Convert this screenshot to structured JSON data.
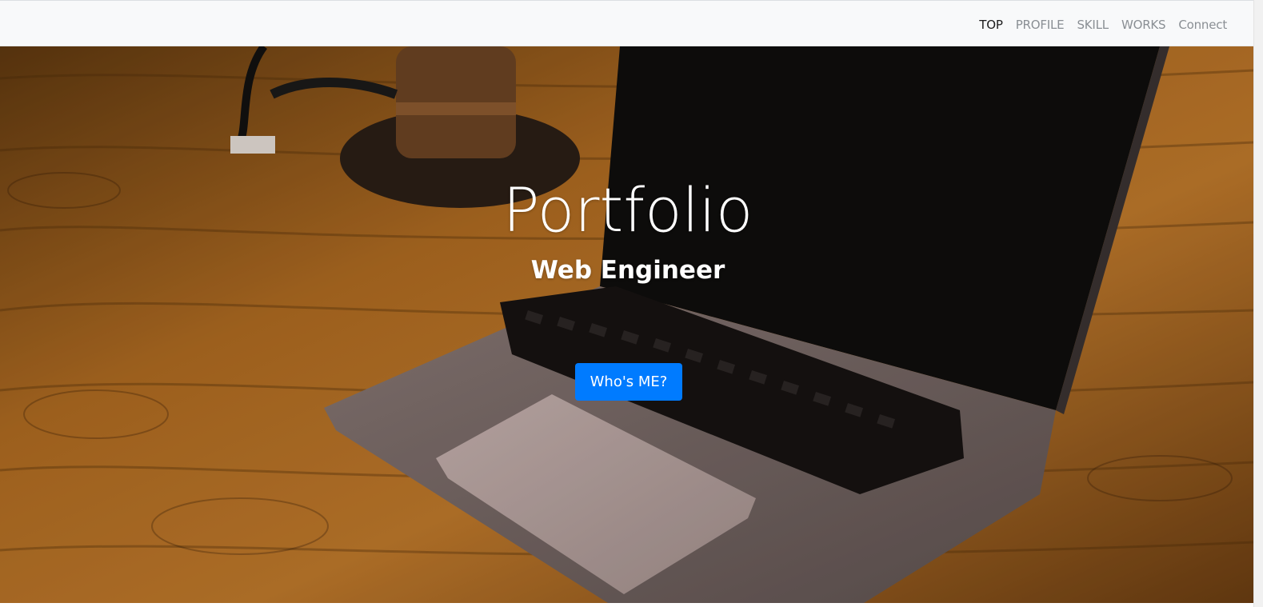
{
  "navbar": {
    "items": [
      {
        "label": "TOP",
        "active": true
      },
      {
        "label": "PROFILE",
        "active": false
      },
      {
        "label": "SKILL",
        "active": false
      },
      {
        "label": "WORKS",
        "active": false
      },
      {
        "label": "Connect",
        "active": false
      }
    ]
  },
  "hero": {
    "title": "Portfolio",
    "subtitle": "Web Engineer",
    "button_label": "Who's ME?",
    "background_image": "laptop-on-wooden-desk-photo"
  },
  "colors": {
    "navbar_bg": "#f8f9fa",
    "nav_active": "#1c1c1c",
    "nav_inactive": "#8a8f94",
    "button_primary": "#007bff",
    "hero_text": "#ffffff"
  }
}
